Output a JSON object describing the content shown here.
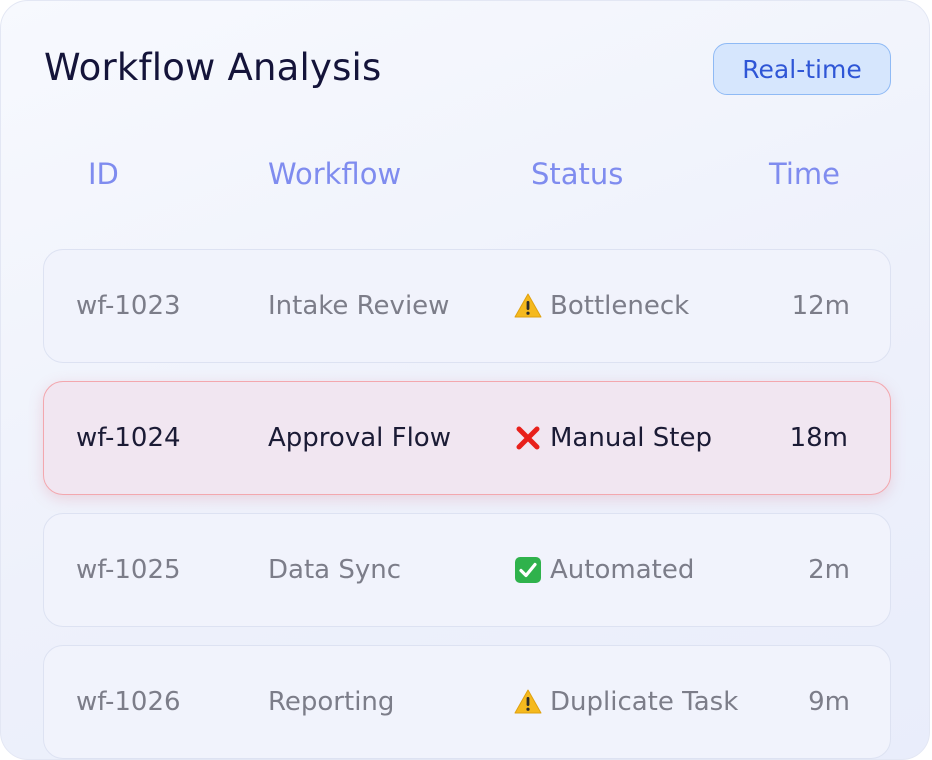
{
  "panel": {
    "title": "Workflow Analysis",
    "badge": "Real-time"
  },
  "table": {
    "headers": {
      "id": "ID",
      "workflow": "Workflow",
      "status": "Status",
      "time": "Time"
    },
    "rows": [
      {
        "id": "wf-1023",
        "workflow": "Intake Review",
        "status": "Bottleneck",
        "status_icon": "warning-icon",
        "time": "12m"
      },
      {
        "id": "wf-1024",
        "workflow": "Approval Flow",
        "status": "Manual Step",
        "status_icon": "cross-icon",
        "time": "18m",
        "highlight_color": "#f3a7ae"
      },
      {
        "id": "wf-1025",
        "workflow": "Data Sync",
        "status": "Automated",
        "status_icon": "check-icon",
        "time": "2m"
      },
      {
        "id": "wf-1026",
        "workflow": "Reporting",
        "status": "Duplicate Task",
        "status_icon": "warning-icon",
        "time": "9m"
      }
    ]
  },
  "colors": {
    "accent": "#7f8cef",
    "badge_bg": "#d6e6fd",
    "badge_text": "#2f56d6",
    "warning": "#f5b91e",
    "error": "#e8201b",
    "success": "#2fb24c"
  }
}
